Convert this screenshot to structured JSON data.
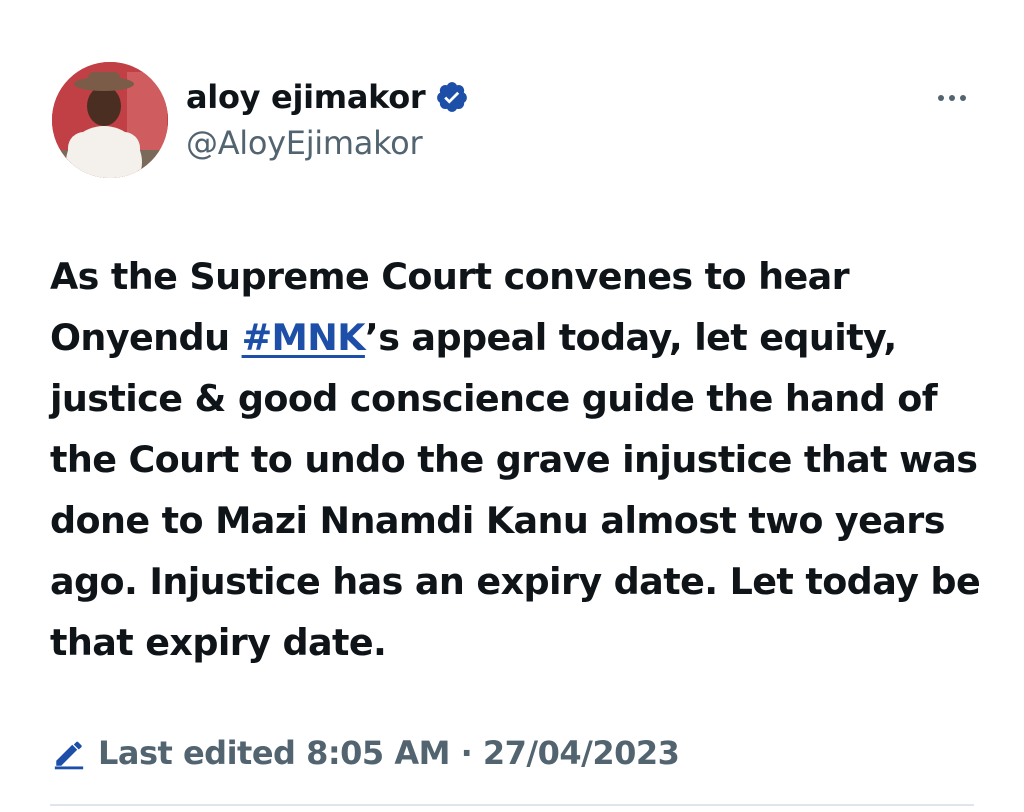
{
  "tweet": {
    "author": {
      "display_name": "aloy ejimakor",
      "handle": "@AloyEjimakor",
      "verified": true
    },
    "text_segments": {
      "part1": "As the Supreme Court convenes to hear Onyendu ",
      "hashtag": "#MNK",
      "part2": "’s appeal today, let equity, justice & good conscience guide the hand of the Court to undo the grave injustice that was done to Mazi Nnamdi Kanu almost two years ago. Injustice has an expiry date. Let today be that expiry date."
    },
    "edit_info": "Last edited 8:05 AM · 27/04/2023"
  },
  "icons": {
    "verified": "verified-badge-icon",
    "more": "more-options-icon",
    "edit": "pencil-icon"
  },
  "colors": {
    "text": "#0f1419",
    "secondary": "#536471",
    "link": "#1d4fa8",
    "verified_badge": "#1d4fa8"
  }
}
